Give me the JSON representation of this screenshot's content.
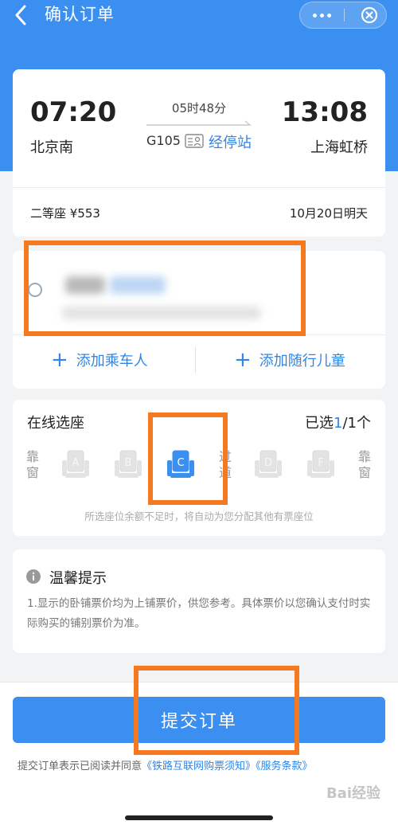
{
  "nav": {
    "title": "确认订单",
    "back_icon": "chevron-left-icon",
    "more_icon": "more-dots-icon",
    "close_icon": "close-circle-icon"
  },
  "trip": {
    "departure_time": "07:20",
    "arrival_time": "13:08",
    "departure_station": "北京南",
    "arrival_station": "上海虹桥",
    "duration": "05时48分",
    "train_number": "G105",
    "stops_link": "经停站",
    "seat_class": "二等座 ¥553",
    "date": "10月20日明天"
  },
  "passengers": {
    "add_adult": "添加乘车人",
    "add_child": "添加随行儿童"
  },
  "seat_selection": {
    "title": "在线选座",
    "selected_prefix": "已选",
    "selected_count": "1",
    "selected_suffix": "/1个",
    "window_label": "靠窗",
    "aisle_label": "过道",
    "seats": [
      "A",
      "B",
      "C",
      "D",
      "F"
    ],
    "selected_seat": "C",
    "note": "所选座位余额不足时，将自动为您分配其他有票座位"
  },
  "tips": {
    "title": "温馨提示",
    "text": "1.显示的卧铺票价均为上铺票价，供您参考。具体票价以您确认支付时实际购买的铺别票价为准。"
  },
  "footer": {
    "submit_label": "提交订单",
    "agree_prefix": "提交订单表示已阅读并同意",
    "link_1": "《铁路互联网购票须知》",
    "link_2": "《服务条款》"
  },
  "colors": {
    "brand_blue": "#3a8ff0",
    "link_blue": "#2f86e8",
    "highlight_orange": "#f47920"
  },
  "watermark": "Bai经验"
}
